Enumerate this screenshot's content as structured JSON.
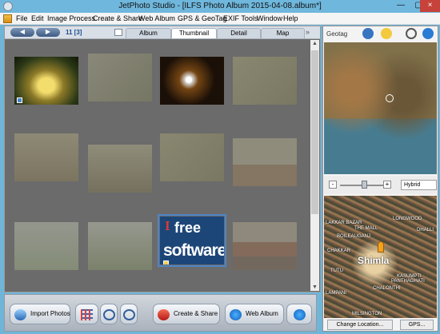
{
  "window": {
    "title": "JetPhoto Studio - [ILFS Photo Album 2015-04-08.album*]",
    "minimize": "—",
    "maximize": "▢",
    "close": "×",
    "app_icon": "camera-icon"
  },
  "menu": {
    "items": [
      "File",
      "Edit",
      "Image Process",
      "Create & Share",
      "Web Album",
      "GPS & GeoTag",
      "EXIF Tools",
      "Window",
      "Help"
    ]
  },
  "viewer": {
    "back": "◀",
    "forward": "▶",
    "counter": "11 [3]",
    "tabs": [
      "Album",
      "Thumbnail",
      "Detail",
      "Map"
    ],
    "more": "»",
    "scroll_up": "▲",
    "scroll_down": "▼",
    "selected_logo": {
      "line1_i": "I",
      "line1_free": "free",
      "line2": "software"
    }
  },
  "bottom_toolbar": {
    "import_label": "Import Photos",
    "create_share_label": "Create & Share",
    "web_album_label": "Web Album"
  },
  "geotag": {
    "title": "Geotag",
    "map_type": "Hybrid",
    "zoom_minus": "-",
    "zoom_plus": "+",
    "labels": {
      "longwood": "LONGWOOD",
      "lakkar": "LAKKAR BAZAR",
      "mall": "THE MALL",
      "shimla": "Shimla",
      "dhalli": "DHALLI",
      "chakkar": "CHAKKAR",
      "boileauganj": "BOILEAUGANJ",
      "kasumpti": "KASUMPTI",
      "tutu": "TUTU",
      "panthaghati": "PANTHAGHATI",
      "chalonthi": "CHALONTHI",
      "milsington": "MILSINGTON",
      "lampani": "LAMPANI"
    },
    "change_location": "Change Location...",
    "gps": "GPS..."
  },
  "colors": {
    "titlebar": "#6fb7dc",
    "viewer_background": "#6b6b6b",
    "selection": "#4e85c6"
  }
}
